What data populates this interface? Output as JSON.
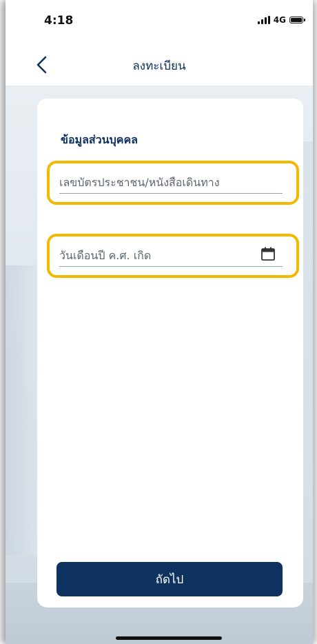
{
  "status_bar": {
    "time": "4:18",
    "network": "4G",
    "icons": [
      "signal-icon",
      "battery-icon"
    ]
  },
  "nav": {
    "title": "ลงทะเบียน",
    "back_icon": "chevron-left-icon"
  },
  "form": {
    "section_title": "ข้อมูลส่วนบุคคล",
    "id_field": {
      "placeholder": "เลขบัตรประชาชน/หนังสือเดินทาง",
      "value": ""
    },
    "dob_field": {
      "placeholder": "วันเดือนปี ค.ศ. เกิด",
      "value": "",
      "icon": "calendar-icon"
    },
    "next_label": "ถัดไป"
  },
  "colors": {
    "brand_navy": "#0d3260",
    "highlight_yellow": "#f3b800"
  }
}
